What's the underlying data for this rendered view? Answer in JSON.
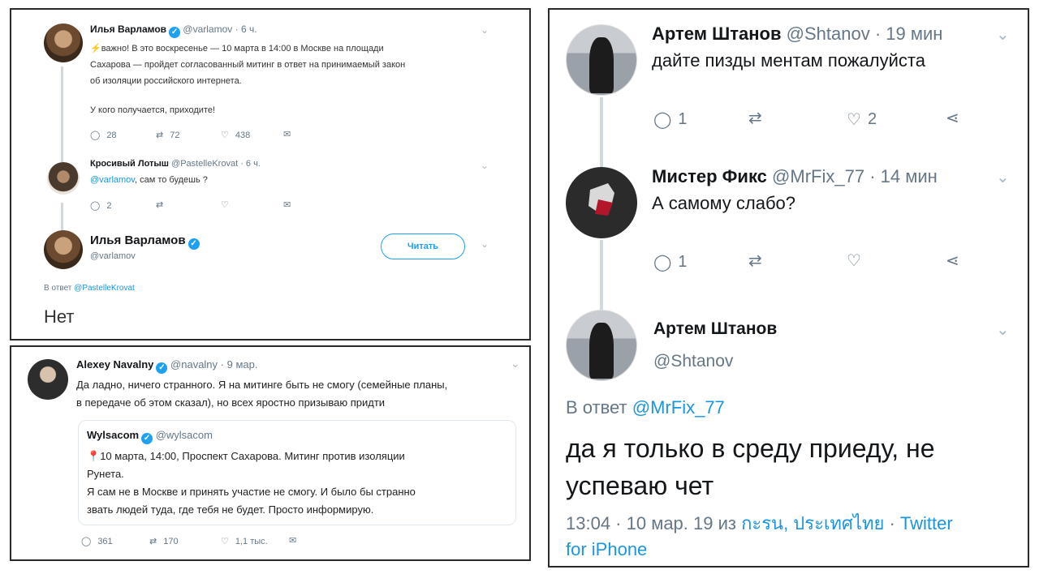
{
  "panel1": {
    "tweet1": {
      "name": "Илья Варламов",
      "handle": "@varlamov",
      "time": "· 6 ч.",
      "line1": "важно! В это воскресенье — 10 марта в 14:00 в Москве на площади",
      "line2": "Сахарова — пройдет согласованный митинг в ответ на принимаемый закон",
      "line3": "об изоляции российского интернета.",
      "line4": "У кого получается, приходите!",
      "replies": "28",
      "retweets": "72",
      "likes": "438"
    },
    "tweet2": {
      "name": "Кросивый Лотыш",
      "handle": "@PastelleKrovat",
      "time": "· 6 ч.",
      "mention": "@varlamov",
      "text": ", сам то будешь ?",
      "replies": "2"
    },
    "tweet3": {
      "name": "Илья Варламов",
      "handle": "@varlamov",
      "follow_label": "Читать",
      "reply_to_prefix": "В ответ",
      "reply_to_handle": "@PastelleKrovat",
      "text": "Нет"
    }
  },
  "panel2": {
    "name": "Alexey Navalny",
    "handle": "@navalny",
    "time": "· 9 мар.",
    "line1": "Да ладно, ничего странного. Я на митинге быть не смогу (семейные планы,",
    "line2": "в передаче об этом сказал), но всех яростно призываю придти",
    "quote": {
      "name": "Wylsacom",
      "handle": "@wylsacom",
      "line1": "10 марта, 14:00, Проспект Сахарова. Митинг против изоляции",
      "line2": "Рунета.",
      "line3": "Я сам не в Москве и принять участие не смогу. И было бы странно",
      "line4": "звать людей туда, где тебя не будет. Просто информирую."
    },
    "replies": "361",
    "retweets": "170",
    "likes": "1,1 тыс."
  },
  "panel3": {
    "tweet1": {
      "name": "Артем Штанов",
      "handle": "@Shtanov",
      "time": "· 19 мин",
      "text": "дайте пизды ментам пожалуйста",
      "replies": "1",
      "likes": "2"
    },
    "tweet2": {
      "name": "Мистер Фикс",
      "handle": "@MrFix_77",
      "time": "· 14 мин",
      "text": "А самому слабо?",
      "replies": "1"
    },
    "tweet3": {
      "name": "Артем Штанов",
      "handle": "@Shtanov",
      "reply_to_prefix": "В ответ",
      "reply_to_handle": "@MrFix_77",
      "line1": "да я только в среду приеду, не",
      "line2": "успеваю чет",
      "meta_time": "13:04 · 10 мар. 19 из",
      "meta_place": "กะรน, ประเทศไทย",
      "meta_sep": " · ",
      "meta_source1": "Twitter",
      "meta_source2": "for iPhone"
    }
  },
  "colors": {
    "accent": "#1b95e0",
    "muted": "#657786",
    "line": "#cfd9de"
  },
  "icons": [
    "reply-icon",
    "retweet-icon",
    "like-icon",
    "share-icon",
    "dm-icon",
    "chevron-down-icon",
    "verified-icon",
    "bolt-icon",
    "pin-icon"
  ]
}
